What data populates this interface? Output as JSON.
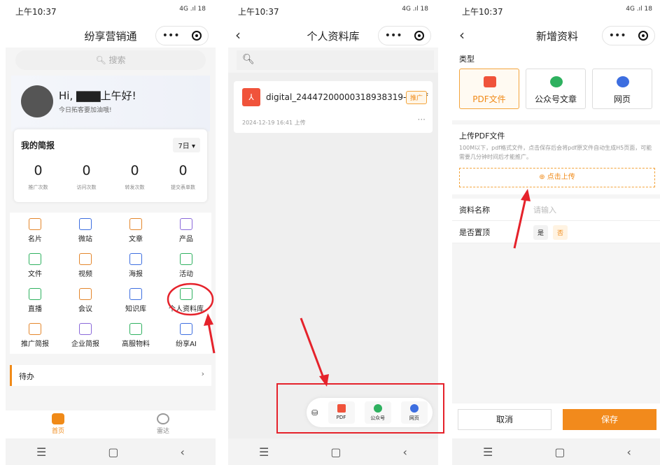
{
  "status": {
    "time": "上午10:37",
    "icons": "4G .ıl 18"
  },
  "capsule": {
    "more": "•••"
  },
  "phone1": {
    "title": "纷享营销通",
    "search": "搜索",
    "greeting": "Hi, ▇▇▇上午好!",
    "greeting_sub": "今日拓客要加油哦!",
    "report_title": "我的简报",
    "range": "7日 ▾",
    "stats": [
      {
        "value": "0",
        "label": "推广次数"
      },
      {
        "value": "0",
        "label": "访问次数"
      },
      {
        "value": "0",
        "label": "转发次数"
      },
      {
        "value": "0",
        "label": "提交表单数"
      }
    ],
    "grid": [
      "名片",
      "微站",
      "文章",
      "产品",
      "文件",
      "视频",
      "海报",
      "活动",
      "直播",
      "会议",
      "知识库",
      "个人资料库",
      "推广简报",
      "企业简报",
      "高服物料",
      "纷享AI"
    ],
    "todo": "待办",
    "tabs": [
      "首页",
      "雷达"
    ]
  },
  "phone2": {
    "title": "个人资料库",
    "file_name": "digital_24447200000318938319-1.pdf",
    "tag": "推广",
    "date": "2024-12-19 16:41 上传",
    "more": "···",
    "fab": [
      "PDF",
      "公众号",
      "网页"
    ]
  },
  "phone3": {
    "title": "新增资料",
    "type_label": "类型",
    "types": [
      "PDF文件",
      "公众号文章",
      "网页"
    ],
    "upload_title": "上传PDF文件",
    "upload_hint": "100M以下，pdf格式文件，点击保存后会将pdf原文件自动生成H5页面，可能需要几分钟时间后才能推广。",
    "upload_btn": "⊕ 点击上传",
    "name_label": "资料名称",
    "name_placeholder": "请输入",
    "top_label": "是否置顶",
    "yes": "是",
    "no": "否",
    "cancel": "取消",
    "save": "保存"
  },
  "nav": {
    "menu": "☰",
    "home": "▢",
    "back": "‹"
  },
  "colors": {
    "accent": "#f08a18",
    "annotation": "#e5222b"
  }
}
